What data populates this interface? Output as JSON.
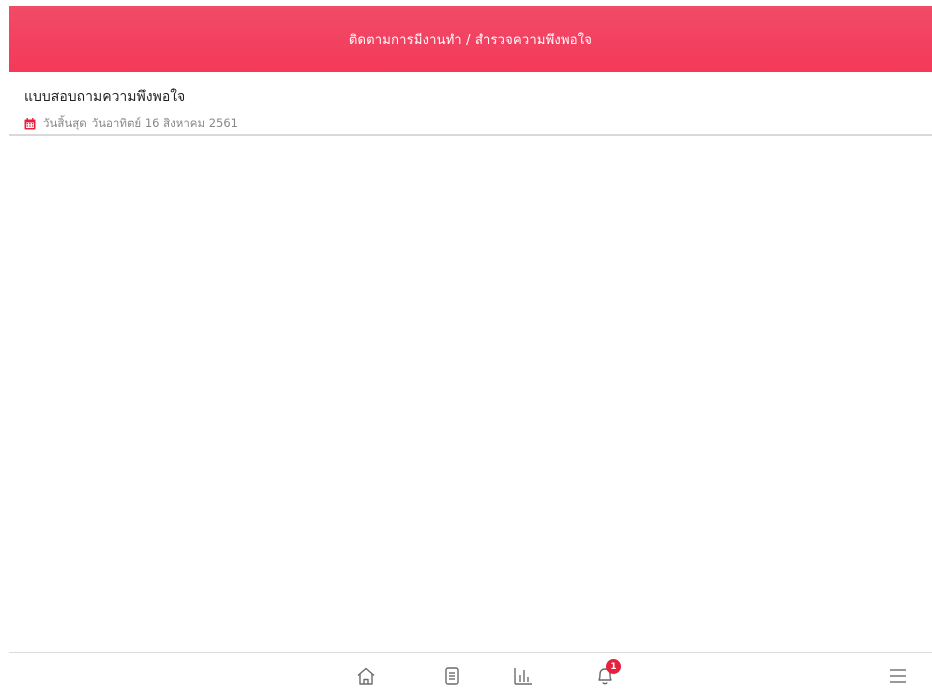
{
  "header": {
    "title": "ติดตามการมีงานทำ / สำรวจความพึงพอใจ"
  },
  "survey_list": [
    {
      "title": "แบบสอบถามความพึงพอใจ",
      "deadline_label": "วันสิ้นสุด",
      "deadline_value": "วันอาทิตย์ 16 สิงหาคม 2561"
    }
  ],
  "bottom_nav": {
    "items": [
      {
        "icon": "home-icon"
      },
      {
        "icon": "document-icon"
      },
      {
        "icon": "bar-chart-icon"
      },
      {
        "icon": "bell-icon",
        "badge": "1"
      },
      {
        "icon": "menu-icon"
      }
    ]
  },
  "colors": {
    "header_bg": "#f4395a",
    "badge_bg": "#e8203f",
    "calendar_icon": "#e8203f",
    "icon_gray": "#6b6b6b"
  }
}
